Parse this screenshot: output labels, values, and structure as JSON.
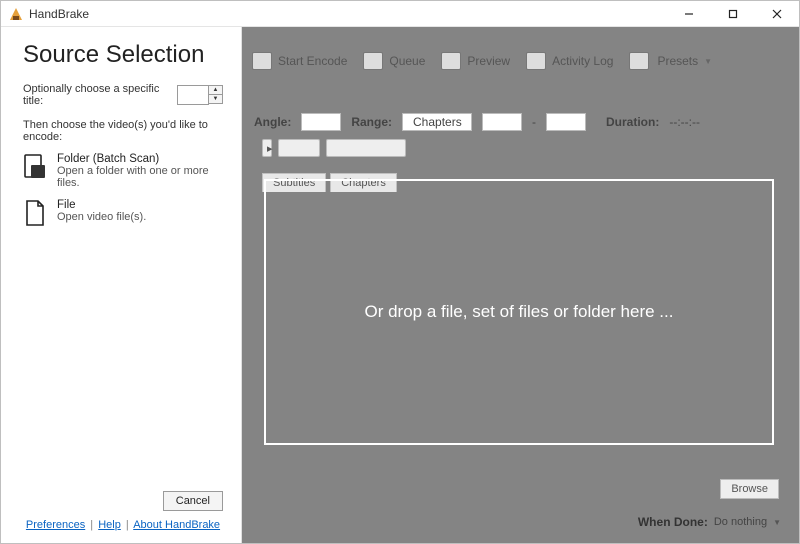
{
  "window": {
    "title": "HandBrake"
  },
  "toolbar": {
    "start_encode": "Start Encode",
    "queue": "Queue",
    "preview": "Preview",
    "activity_log": "Activity Log",
    "presets": "Presets"
  },
  "bg": {
    "angle_label": "Angle:",
    "range_label": "Range:",
    "range_value": "Chapters",
    "range_sep": "-",
    "duration_label": "Duration:",
    "duration_value": "--:--:--",
    "pill1": "",
    "pill2": "",
    "tab_subs": "Subtitles",
    "tab_chapters": "Chapters",
    "browse": "Browse",
    "when_done_label": "When Done:",
    "when_done_value": "Do nothing"
  },
  "panel": {
    "heading": "Source Selection",
    "title_label": "Optionally choose a specific title:",
    "spinner_value": "",
    "encode_label": "Then choose the video(s) you'd like to encode:",
    "folder_title": "Folder (Batch Scan)",
    "folder_sub": "Open a folder with one or more files.",
    "file_title": "File",
    "file_sub": "Open video file(s).",
    "cancel": "Cancel",
    "links": {
      "prefs": "Preferences",
      "help": "Help",
      "about": "About HandBrake"
    }
  },
  "dropzone": {
    "text": "Or drop a file, set of files or folder here ..."
  }
}
